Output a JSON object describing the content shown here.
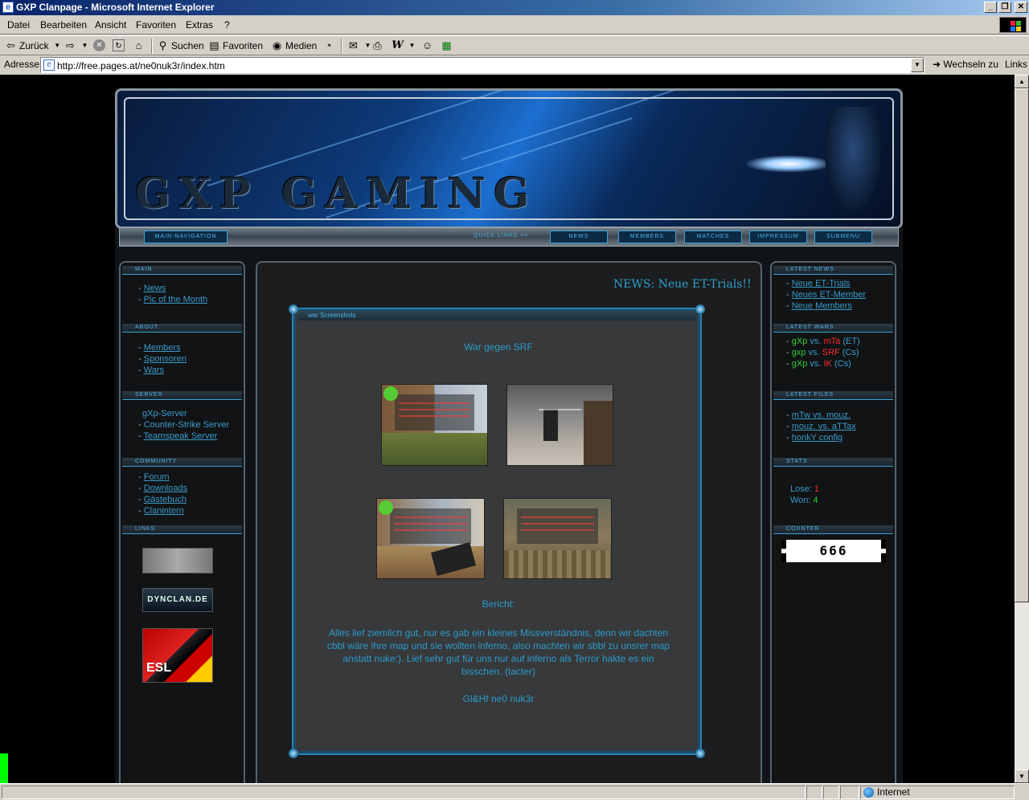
{
  "window": {
    "title": "GXP Clanpage - Microsoft Internet Explorer",
    "min_btn": "_",
    "max_btn": "❐",
    "close_btn": "✕"
  },
  "menu": [
    "Datei",
    "Bearbeiten",
    "Ansicht",
    "Favoriten",
    "Extras",
    "?"
  ],
  "toolbar": {
    "back": "Zurück",
    "search": "Suchen",
    "favorites": "Favoriten",
    "media": "Medien"
  },
  "address": {
    "label": "Adresse",
    "url": "http://free.pages.at/ne0nuk3r/index.htm",
    "go": "Wechseln zu",
    "links": "Links"
  },
  "status": {
    "zone": "Internet"
  },
  "site": {
    "banner_title": "GXP GAMING",
    "nav": {
      "main_navigation": "MAIN-NAVIGATION",
      "quick_links": "QUICK LINKS >>",
      "items": [
        "NEWS",
        "MEMBERS",
        "MATCHES",
        "IMPRESSUM",
        "SUBMENU"
      ]
    },
    "left": {
      "main_head": "MAIN",
      "main_links": [
        "News",
        "Pic of the Month"
      ],
      "about_head": "ABOUT",
      "about_links": [
        "Members",
        "Sponsoren",
        "Wars"
      ],
      "server_head": "SERVER",
      "server_links": [
        "gXp-Server",
        "Counter-Strike Server",
        "Teamspeak Server"
      ],
      "community_head": "COMMUNITY",
      "community_links": [
        "Forum",
        "Downloads",
        "Gästebuch",
        "Clanintern"
      ],
      "links_head": "LINKS",
      "link_images": [
        "",
        "DYNCLAN.DE",
        "ESL"
      ]
    },
    "center": {
      "news_title": "NEWS: Neue ET-Trials!!",
      "box_title": "war Screenshots",
      "war_title": "War gegen SRF",
      "report_label": "Bericht:",
      "report_text": "Alles lief ziemlich gut, nur es gab ein kleines Missverständnis, denn wir dachten cbbl wäre ihre map und sie wollten inferno, also machten wir sbbl zu unsrer map anstatt nuke:). Lief sehr gut für uns nur auf inferno als Terror hakte es ein bisschen. (tacter)",
      "signoff": "Gl&Hf ne0 nuk3r"
    },
    "right": {
      "news_head": "LATEST NEWS",
      "news_links": [
        "Neue ET-Trials",
        "Neues ET-Member",
        "Neue Members"
      ],
      "wars_head": "LATEST WARS",
      "wars": [
        {
          "team": "gXp",
          "vs": "vs.",
          "opp": "mTa",
          "game": "(ET)"
        },
        {
          "team": "gxp",
          "vs": "vs.",
          "opp": "SRF",
          "game": "(Cs)"
        },
        {
          "team": "gXp",
          "vs": "vs.",
          "opp": "IK",
          "game": "(Cs)"
        }
      ],
      "files_head": "LATEST FILES",
      "files": [
        "mTw vs. mouz.",
        "mouz. vs. aTTax",
        "honkY config"
      ],
      "stats_head": "STATS",
      "lose_label": "Lose:",
      "lose_value": "1",
      "won_label": "Won:",
      "won_value": "4",
      "counter_head": "COUNTER",
      "counter_value": "666"
    }
  },
  "colors": {
    "accent": "#3b9bc9",
    "win": "#33cc33",
    "loss": "#ff2a2a"
  }
}
